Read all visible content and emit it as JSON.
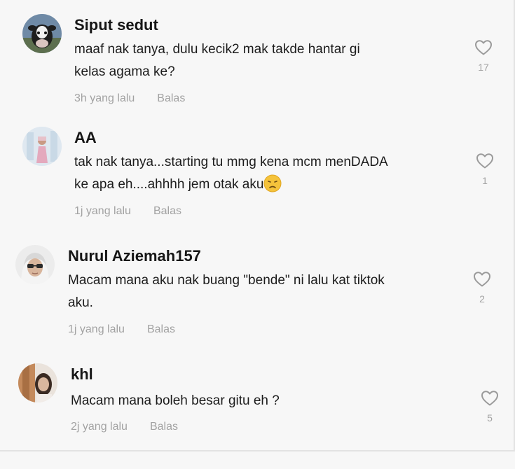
{
  "comments": [
    {
      "username": "Siput sedut",
      "text": "maaf nak tanya, dulu kecik2 mak takde hantar gi\nkelas agama ke?",
      "time": "3h yang lalu",
      "reply": "Balas",
      "likes": "17"
    },
    {
      "username": "AA",
      "text_before_emoji": "tak nak tanya...starting tu mmg kena mcm menDADA\nke apa eh....ahhhh jem otak aku",
      "emoji": "sad-face-emoji",
      "time": "1j yang lalu",
      "reply": "Balas",
      "likes": "1"
    },
    {
      "username": "Nurul Aziemah157",
      "text": "Macam mana aku nak buang \"bende\" ni lalu kat tiktok\naku.",
      "time": "1j yang lalu",
      "reply": "Balas",
      "likes": "2"
    },
    {
      "username": "khl",
      "text": "Macam mana boleh besar gitu eh ?",
      "time": "2j yang lalu",
      "reply": "Balas",
      "likes": "5"
    }
  ],
  "colors": {
    "background": "#f7f7f7",
    "username": "#161616",
    "text": "#1c1c1c",
    "meta": "#a2a2a2",
    "heart_outline": "#9a9a9a"
  },
  "icons": {
    "like": "heart-outline-icon"
  }
}
